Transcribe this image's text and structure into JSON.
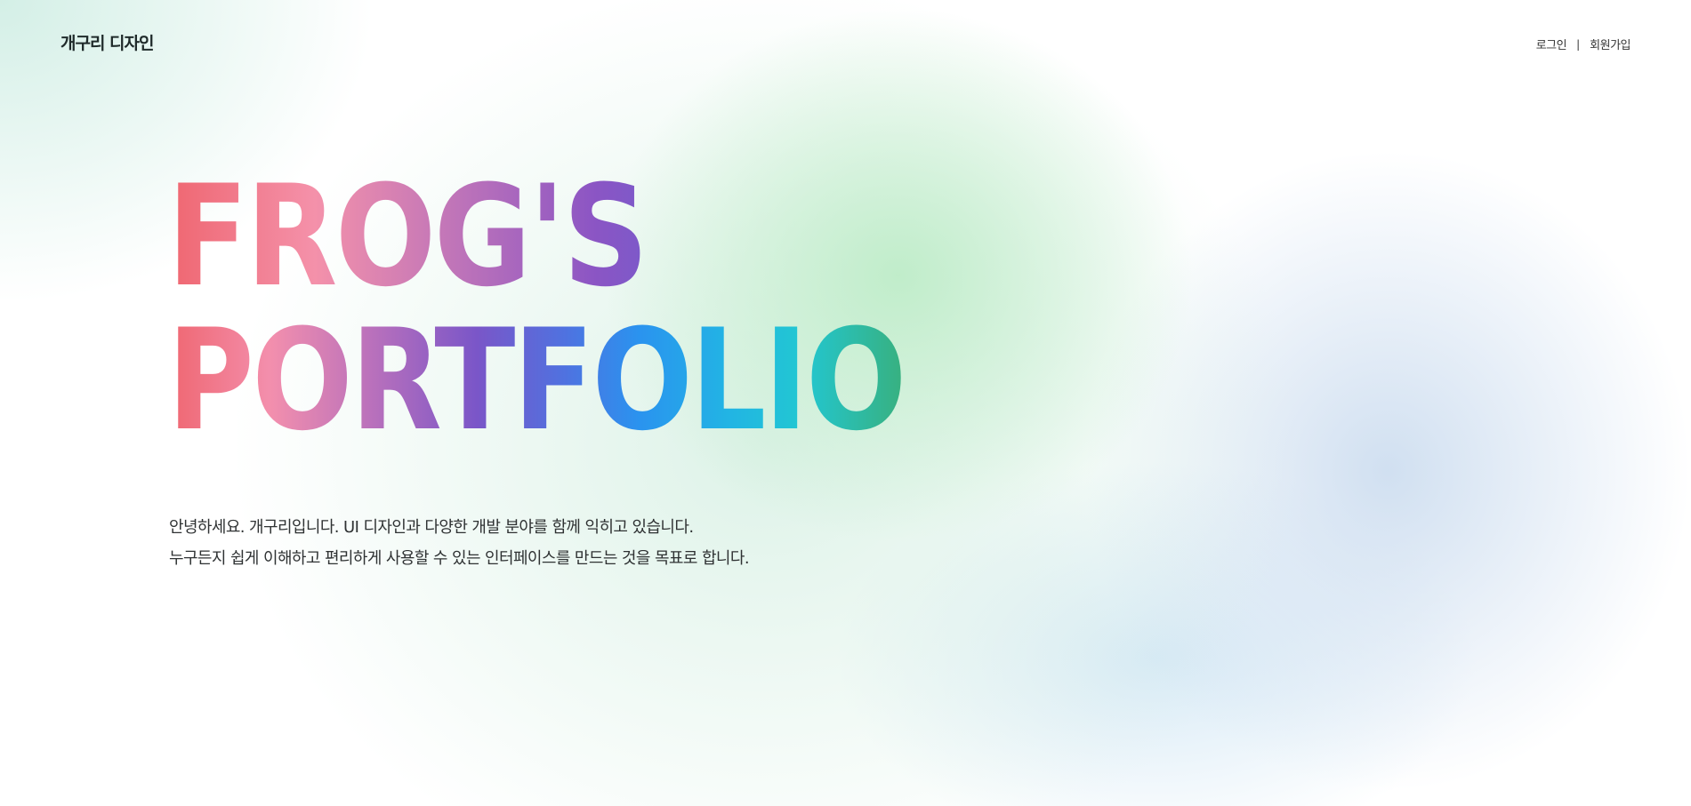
{
  "header": {
    "logo": "개구리 디자인",
    "nav": {
      "login": "로그인",
      "separator": "|",
      "signup": "회원가입"
    }
  },
  "hero": {
    "title_line1": "FROG'S",
    "title_line2": "PORTFOLIO",
    "intro_line1": "안녕하세요. 개구리입니다. UI 디자인과 다양한 개발 분야를 함께 익히고 있습니다.",
    "intro_line2": "누구든지 쉽게 이해하고 편리하게 사용할 수 있는 인터페이스를 만드는 것을 목표로 합니다."
  },
  "colors": {
    "title_gradient": [
      "#ef6670",
      "#f491aa",
      "#8b55c4",
      "#2d8ae8",
      "#22c7d2",
      "#38b07e"
    ],
    "background_blobs": [
      "#b0e2d2",
      "#beecc8",
      "#cedef0"
    ]
  }
}
